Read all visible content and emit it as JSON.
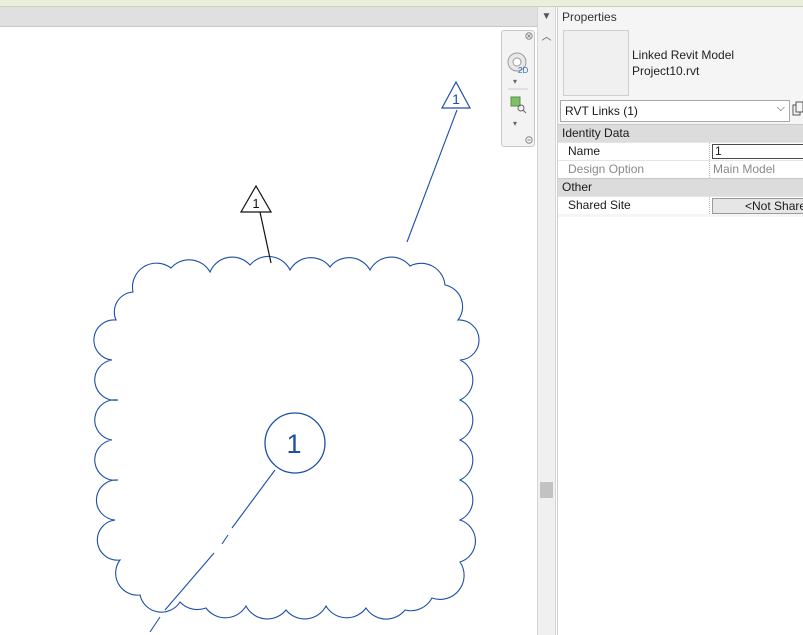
{
  "properties": {
    "title": "Properties",
    "type_family": "Linked Revit Model",
    "type_name": "Project10.rvt",
    "selector_value": "RVT Links (1)",
    "groups": [
      {
        "name": "Identity Data",
        "rows": [
          {
            "label": "Name",
            "value": "1",
            "editable": true
          },
          {
            "label": "Design Option",
            "value": "Main Model",
            "editable": false
          }
        ]
      },
      {
        "name": "Other",
        "rows": [
          {
            "label": "Shared Site",
            "value": "<Not Shared>",
            "editable": true
          }
        ]
      }
    ]
  },
  "canvas": {
    "revision_tag_small": "1",
    "revision_tag_large": "1",
    "revision_tag_circle": "1",
    "colors": {
      "line": "#1c4fa8",
      "black": "#111111"
    }
  },
  "navbar": {
    "zoom_badge": "2D"
  }
}
